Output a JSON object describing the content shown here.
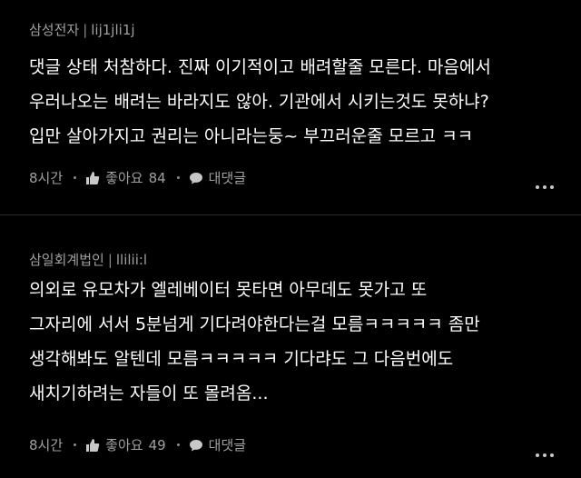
{
  "comments": [
    {
      "author": "삼성전자",
      "separator": "|",
      "user_id": "lij1jli1j",
      "body_lines": [
        "댓글 상태 처참하다. 진짜 이기적이고 배려할줄 모른다. 마음에서",
        "우러나오는 배려는 바라지도 않아. 기관에서 시키는것도 못하냐?",
        "입만 살아가지고 권리는 아니라는둥~ 부끄러운줄 모르고 ㅋㅋ"
      ],
      "time": "8시간",
      "like_label": "좋아요",
      "like_count": "84",
      "reply_label": "대댓글"
    },
    {
      "author": "삼일회계법인",
      "separator": "|",
      "user_id": "llilii:l",
      "body_lines": [
        "의외로 유모차가 엘레베이터 못타면 아무데도 못가고 또",
        "그자리에 서서 5분넘게 기다려야한다는걸 모름ㅋㅋㅋㅋㅋ 좀만",
        "생각해봐도 알텐데 모름ㅋㅋㅋㅋㅋ 기다랴도 그 다음번에도",
        "새치기하려는 자들이 또 몰려옴..."
      ],
      "time": "8시간",
      "like_label": "좋아요",
      "like_count": "49",
      "reply_label": "대댓글"
    }
  ],
  "icons": {
    "like": "thumbs-up-icon",
    "reply": "speech-bubble-icon",
    "more": "more-dots-icon"
  },
  "colors": {
    "background": "#000000",
    "text": "#ffffff",
    "meta": "#a0a0a0"
  }
}
